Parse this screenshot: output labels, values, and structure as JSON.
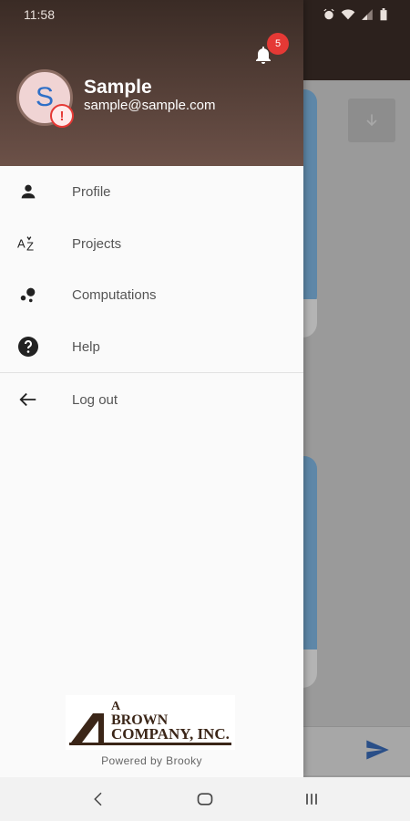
{
  "status_bar": {
    "time": "11:58"
  },
  "drawer": {
    "user": {
      "initial": "S",
      "name": "Sample",
      "email": "sample@sample.com"
    },
    "notifications": {
      "count": "5"
    },
    "menu": [
      {
        "label": "Profile",
        "icon": "person-icon"
      },
      {
        "label": "Projects",
        "icon": "sort-az-icon"
      },
      {
        "label": "Computations",
        "icon": "bubbles-icon"
      },
      {
        "label": "Help",
        "icon": "help-icon"
      },
      {
        "label": "Log out",
        "icon": "arrow-left-icon"
      }
    ],
    "logo": {
      "line1": "A",
      "line2": "BROWN",
      "line3": "COMPANY, INC."
    },
    "powered_by": "Powered by Brooky"
  },
  "colors": {
    "header_top": "#3a2b25",
    "header_bottom": "#6c5148",
    "badge": "#e53935",
    "avatar_letter": "#2e6fc7"
  }
}
